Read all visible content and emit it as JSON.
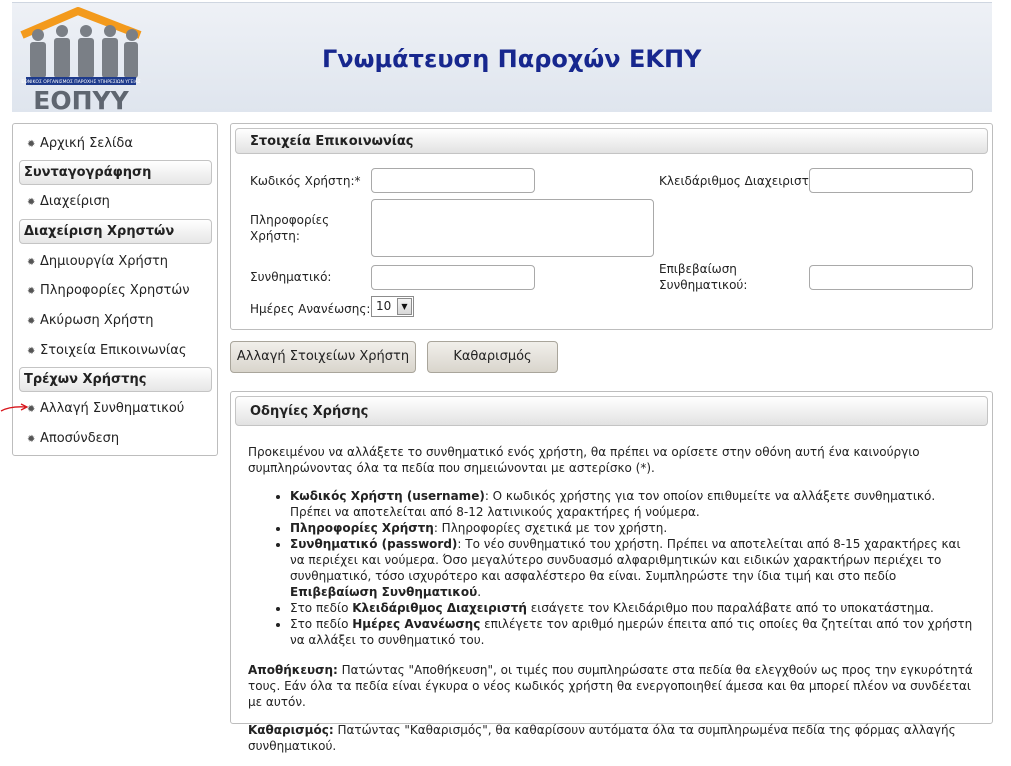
{
  "header": {
    "title": "Γνωμάτευση Παροχών ΕΚΠΥ",
    "logo_text": "ΕΟΠΥΥ",
    "logo_subtext": "ΕΘΝΙΚΟΣ ΟΡΓΑΝΙΣΜΟΣ ΠΑΡΟΧΗΣ ΥΠΗΡΕΣΙΩΝ ΥΓΕΙΑΣ"
  },
  "sidebar": {
    "home": "Αρχική Σελίδα",
    "section_prescription": "Συνταγογράφηση",
    "management": "Διαχείριση",
    "section_users": "Διαχείριση Χρηστών",
    "create_user": "Δημιουργία Χρήστη",
    "users_info": "Πληροφορίες Χρηστών",
    "cancel_user": "Ακύρωση Χρήστη",
    "contact_info": "Στοιχεία Επικοινωνίας",
    "section_current_user": "Τρέχων Χρήστης",
    "change_password": "Αλλαγή Συνθηματικού",
    "logout": "Αποσύνδεση"
  },
  "form": {
    "title": "Στοιχεία Επικοινωνίας",
    "username_label": "Κωδικός Χρήστη:*",
    "username_value": "",
    "admin_key_label": "Κλειδάριθμος Διαχειριστή:*",
    "admin_key_value": "",
    "user_info_label": "Πληροφορίες Χρήστη:",
    "user_info_value": "",
    "password_label": "Συνθηματικό:",
    "password_value": "",
    "confirm_label": "Επιβεβαίωση Συνθηματικού:",
    "confirm_value": "",
    "renewal_label": "Ημέρες Ανανέωσης:*",
    "renewal_value": "10"
  },
  "buttons": {
    "change": "Αλλαγή Στοιχείων Χρήστη",
    "clear": "Καθαρισμός"
  },
  "instructions": {
    "title": "Οδηγίες Χρήσης",
    "intro": "Προκειμένου να αλλάξετε το συνθηματικό ενός χρήστη, θα πρέπει να ορίσετε στην οθόνη αυτή ένα καινούργιο συμπληρώνοντας όλα τα πεδία που σημειώνονται με αστερίσκο (*).",
    "b1_bold": "Κωδικός Χρήστη (username)",
    "b1_text": ": Ο κωδικός χρήστης για τον οποίον επιθυμείτε να αλλάξετε συνθηματικό. Πρέπει να αποτελείται από 8-12 λατινικούς χαρακτήρες ή νούμερα.",
    "b2_bold": "Πληροφορίες Χρήστη",
    "b2_text": ": Πληροφορίες σχετικά με τον χρήστη.",
    "b3_bold": "Συνθηματικό (password)",
    "b3_text": ": Το νέο συνθηματικό του χρήστη. Πρέπει να αποτελείται από 8-15 χαρακτήρες και να περιέχει και νούμερα. Όσο μεγαλύτερο συνδυασμό αλφαριθμητικών και ειδικών χαρακτήρων περιέχει το συνθηματικό, τόσο ισχυρότερο και ασφαλέστερο θα είναι. Συμπληρώστε την ίδια τιμή και στο πεδίο ",
    "b3_bold2": "Επιβεβαίωση Συνθηματικού",
    "b3_end": ".",
    "b4_pre": "Στο πεδίο ",
    "b4_bold": "Κλειδάριθμος Διαχειριστή",
    "b4_text": " εισάγετε τον Κλειδάριθμο που παραλάβατε από το υποκατάστημα.",
    "b5_pre": "Στο πεδίο ",
    "b5_bold": "Ημέρες Ανανέωσης",
    "b5_text": " επιλέγετε τον αριθμό ημερών έπειτα από τις οποίες θα ζητείται από τον χρήστη να αλλάξει το συνθηματικό του.",
    "save_bold": "Αποθήκευση:",
    "save_text": " Πατώντας \"Αποθήκευση\", οι τιμές που συμπληρώσατε στα πεδία θα ελεγχθούν ως προς την εγκυρότητά τους. Εάν όλα τα πεδία είναι έγκυρα ο νέος κωδικός χρήστη θα ενεργοποιηθεί άμεσα και θα μπορεί πλέον να συνδέεται με αυτόν.",
    "clear_bold": "Καθαρισμός:",
    "clear_text": " Πατώντας \"Καθαρισμός\", θα καθαρίσουν αυτόματα όλα τα συμπληρωμένα πεδία της φόρμας αλλαγής συνθηματικού."
  }
}
